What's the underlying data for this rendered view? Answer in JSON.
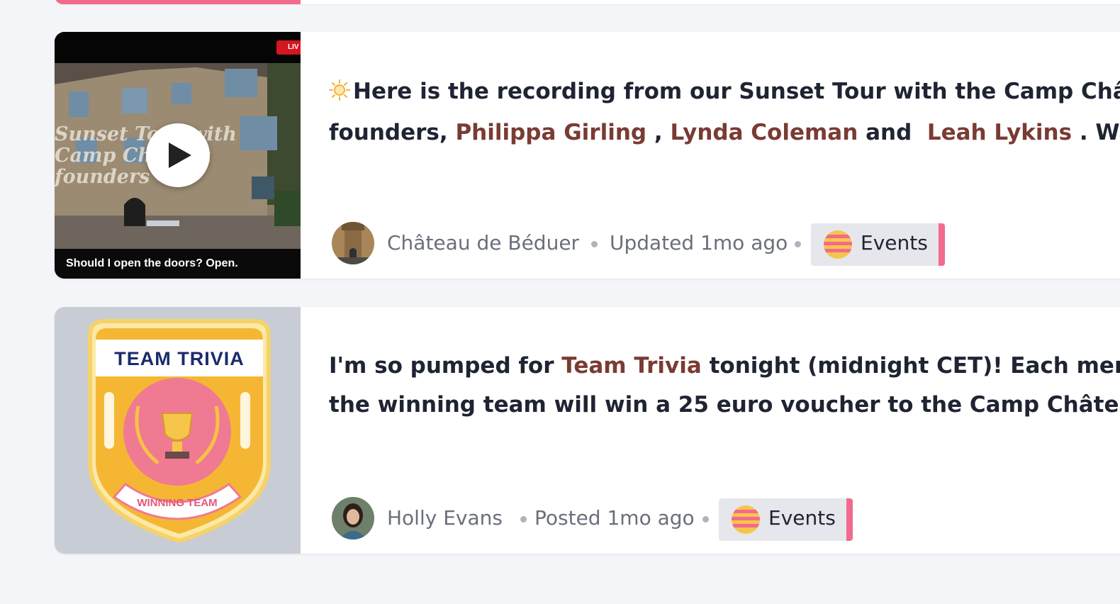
{
  "posts": [
    {
      "thumbnail": {
        "live_label": "LIV",
        "caption": "Should I open the doors? Open.",
        "overlay_text": "Sunset Tour with Camp Château founders"
      },
      "text": {
        "line1_emoji": "☀",
        "line1": "Here is the recording from our Sunset Tour with the Camp Châtea",
        "line2_prefix": "founders, ",
        "mention1": "Philippa Girling",
        "sep1": " , ",
        "mention2": "Lynda Coleman",
        "sep2": " and  ",
        "mention3": "Leah Lykins",
        "line2_suffix": " . Walk"
      },
      "author": "Château de Béduer",
      "timestamp": "Updated 1mo ago",
      "tag": "Events"
    },
    {
      "thumbnail": {
        "badge_title": "TEAM TRIVIA",
        "badge_ribbon": "WINNING TEAM"
      },
      "text": {
        "line1_prefix": "I'm so pumped for ",
        "mention1": "Team Trivia",
        "line1_suffix": " tonight (midnight CET)! Each membe",
        "line2": "the winning team will win a 25 euro voucher to the Camp Château."
      },
      "author": "Holly Evans",
      "timestamp": "Posted 1mo ago",
      "tag": "Events"
    }
  ],
  "colors": {
    "accent_pink": "#f26a8d",
    "mention": "#7a3b33",
    "text": "#1f2433",
    "muted": "#6b6f7c"
  }
}
